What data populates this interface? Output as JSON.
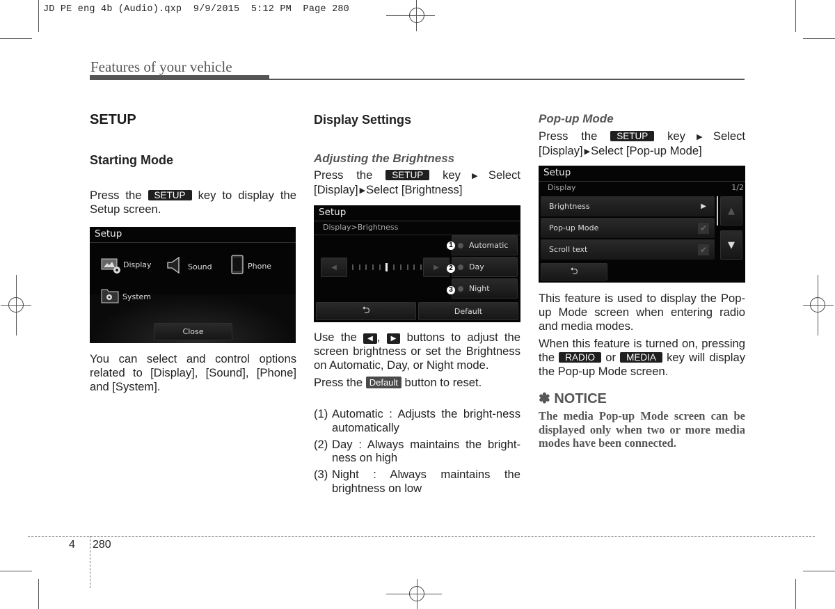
{
  "slug": "JD PE eng 4b (Audio).qxp  9/9/2015  5:12 PM  Page 280",
  "running_head": "Features of your vehicle",
  "col1": {
    "title": "SETUP",
    "subtitle": "Starting Mode",
    "p1_before": "Press the ",
    "p1_key": "SETUP",
    "p1_after": " key to display the Setup screen.",
    "screen": {
      "title": "Setup",
      "items": [
        {
          "label": "Display",
          "icon": "display-settings-icon"
        },
        {
          "label": "Sound",
          "icon": "speaker-icon"
        },
        {
          "label": "Phone",
          "icon": "phone-icon"
        },
        {
          "label": "System",
          "icon": "system-folder-icon"
        }
      ],
      "close_label": "Close"
    },
    "p2": "You can select and control options related to [Display], [Sound], [Phone] and [System]."
  },
  "col2": {
    "title": "Display Settings",
    "subtitle": "Adjusting the Brightness",
    "p1_before": "Press the ",
    "p1_key": "SETUP",
    "p1_mid": " key",
    "p1_sel1": "Select [Display]",
    "p1_sel2": "Select [Brightness]",
    "screen": {
      "title": "Setup",
      "breadcrumb": "Display>Brightness",
      "modes": [
        {
          "num": "1",
          "label": "Automatic"
        },
        {
          "num": "2",
          "label": "Day"
        },
        {
          "num": "3",
          "label": "Night"
        }
      ],
      "brightness_level": "6 of 11",
      "back_icon": "back-arrow-icon",
      "default_label": "Default"
    },
    "p2_a": "Use the ",
    "p2_b": ", ",
    "p2_c": " buttons to adjust the screen brightness or set the Brightness on Automatic, Day, or Night mode.",
    "p3_before": "Press the ",
    "p3_key": "Default",
    "p3_after": " button to reset.",
    "list": [
      {
        "n": "(1)",
        "t": "Automatic : Adjusts the bright-ness automatically"
      },
      {
        "n": "(2)",
        "t": "Day : Always maintains the bright-ness on high"
      },
      {
        "n": "(3)",
        "t": "Night : Always maintains the brightness on low"
      }
    ]
  },
  "col3": {
    "subtitle": "Pop-up Mode",
    "p1_before": "Press the ",
    "p1_key": "SETUP",
    "p1_mid": " key",
    "p1_sel1": "Select [Display]",
    "p1_sel2": "Select [Pop-up Mode]",
    "screen": {
      "title": "Setup",
      "section": "Display",
      "page": "1/2",
      "items": [
        {
          "label": "Brightness",
          "control": "arrow"
        },
        {
          "label": "Pop-up Mode",
          "control": "check"
        },
        {
          "label": "Scroll text",
          "control": "check"
        }
      ]
    },
    "p2": "This feature is used to display the Pop-up Mode screen when entering radio and media modes.",
    "p3_a": "When this feature is turned on, pressing the ",
    "p3_key1": "RADIO",
    "p3_b": " or ",
    "p3_key2": "MEDIA",
    "p3_c": " key will display the Pop-up Mode screen.",
    "notice_title": "✽ NOTICE",
    "notice_body": "The media Pop-up Mode screen can be displayed only when two or more media modes have been connected."
  },
  "footer": {
    "chapter": "4",
    "page": "280"
  }
}
